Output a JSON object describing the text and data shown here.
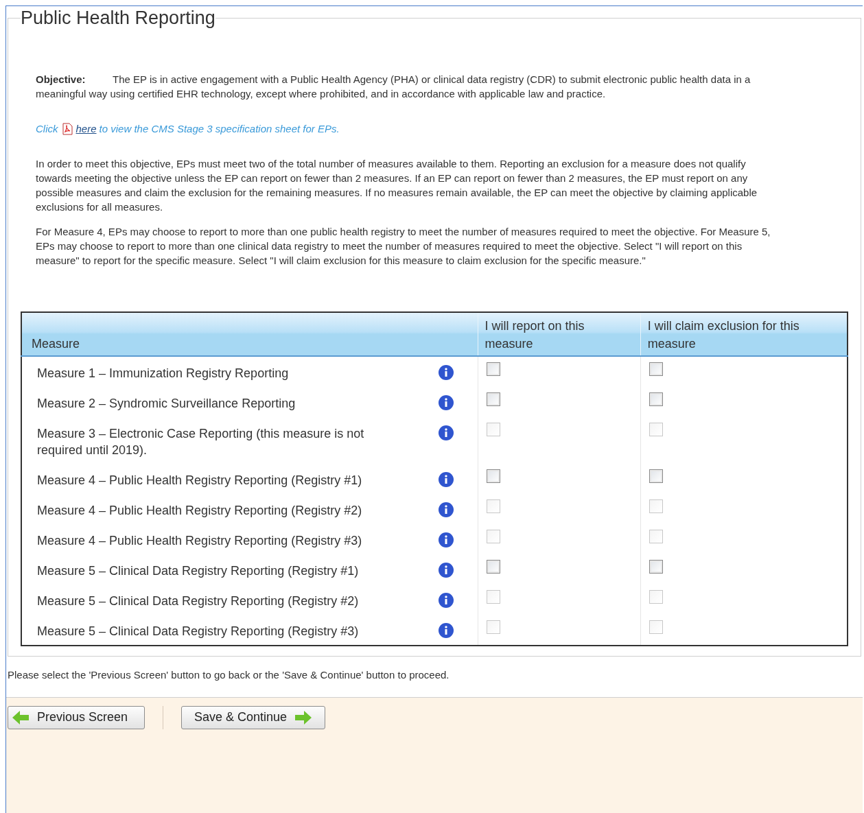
{
  "section_title": "Public Health Reporting",
  "objective": {
    "label": "Objective:",
    "text": "The EP is in active engagement with a Public Health Agency (PHA) or clinical data registry (CDR) to submit electronic public health data in a meaningful way using certified EHR technology, except where prohibited, and in accordance with applicable law and practice."
  },
  "spec_link": {
    "before": "Click",
    "link": "here",
    "after": "to view the CMS Stage 3 specification sheet for EPs."
  },
  "paragraphs": [
    "In order to meet this objective, EPs must meet two of the total number of measures available to them. Reporting an exclusion for a measure does not qualify towards meeting the objective unless the EP can report on fewer than 2 measures. If an EP can report on fewer than 2 measures, the EP must report on any possible measures and claim the exclusion for the remaining measures. If no measures remain available, the EP can meet the objective by claiming applicable exclusions for all measures.",
    "For Measure 4, EPs may choose to report to more than one public health registry to meet the number of measures required to meet the objective. For Measure 5, EPs may choose to report to more than one clinical data registry to meet the number of measures required to meet the objective. Select \"I will report on this measure\" to report for the specific measure. Select \"I will claim exclusion for this measure to claim exclusion for the specific measure.\""
  ],
  "table": {
    "columns": [
      "Measure",
      "I will report on this measure",
      "I will claim exclusion for this measure"
    ],
    "rows": [
      {
        "measure": "Measure 1 – Immunization Registry Reporting",
        "report": {
          "checked": false,
          "disabled": false
        },
        "exclusion": {
          "checked": false,
          "disabled": false
        }
      },
      {
        "measure": "Measure 2 – Syndromic Surveillance Reporting",
        "report": {
          "checked": false,
          "disabled": false
        },
        "exclusion": {
          "checked": false,
          "disabled": false
        }
      },
      {
        "measure": "Measure 3 – Electronic Case Reporting (this measure is not required until 2019).",
        "report": {
          "checked": false,
          "disabled": true
        },
        "exclusion": {
          "checked": false,
          "disabled": true
        }
      },
      {
        "measure": "Measure 4 – Public Health Registry Reporting (Registry #1)",
        "report": {
          "checked": false,
          "disabled": false
        },
        "exclusion": {
          "checked": false,
          "disabled": false
        }
      },
      {
        "measure": "Measure 4 – Public Health Registry Reporting (Registry #2)",
        "report": {
          "checked": false,
          "disabled": true
        },
        "exclusion": {
          "checked": false,
          "disabled": true
        }
      },
      {
        "measure": "Measure 4 – Public Health Registry Reporting (Registry #3)",
        "report": {
          "checked": false,
          "disabled": true
        },
        "exclusion": {
          "checked": false,
          "disabled": true
        }
      },
      {
        "measure": "Measure 5 – Clinical Data Registry Reporting (Registry #1)",
        "report": {
          "checked": false,
          "disabled": false
        },
        "exclusion": {
          "checked": false,
          "disabled": false
        }
      },
      {
        "measure": "Measure 5 – Clinical Data Registry Reporting (Registry #2)",
        "report": {
          "checked": false,
          "disabled": true
        },
        "exclusion": {
          "checked": false,
          "disabled": true
        }
      },
      {
        "measure": "Measure 5 – Clinical Data Registry Reporting (Registry #3)",
        "report": {
          "checked": false,
          "disabled": true
        },
        "exclusion": {
          "checked": false,
          "disabled": true
        }
      }
    ]
  },
  "instruction": "Please select the 'Previous Screen' button to go back or the 'Save & Continue' button to proceed.",
  "buttons": [
    {
      "label": "Previous Screen",
      "kind": "back"
    },
    {
      "label": "Save & Continue",
      "kind": "next"
    }
  ]
}
